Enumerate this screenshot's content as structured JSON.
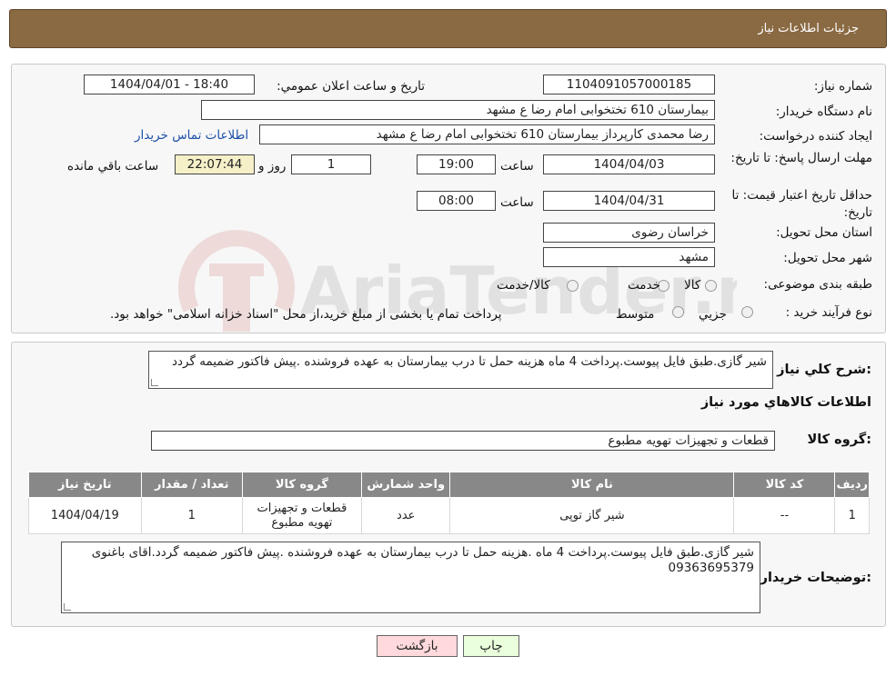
{
  "header": {
    "title": "جزئیات اطلاعات نیاز"
  },
  "form": {
    "need_number_label": "شماره نیاز:",
    "need_number": "1104091057000185",
    "announce_label": "تاریخ و ساعت اعلان عمومي:",
    "announce_value": "1404/04/01 - 18:40",
    "buyer_org_label": "نام دستگاه خریدار:",
    "buyer_org": "بیمارستان 610 تختخوابی امام رضا ع  مشهد",
    "creator_label": "ایجاد کننده درخواست:",
    "creator": "رضا محمدی کارپرداز بیمارستان 610 تختخوابی امام رضا ع  مشهد",
    "contact_link": "اطلاعات تماس خریدار",
    "deadline_label": "مهلت ارسال پاسخ: تا تاریخ:",
    "deadline_date": "1404/04/03",
    "time_label": "ساعت",
    "deadline_time": "19:00",
    "days_value": "1",
    "days_label": "روز و",
    "remaining_time": "22:07:44",
    "remaining_label": "ساعت باقي مانده",
    "validity_label": "حداقل تاریخ اعتبار قیمت: تا تاریخ:",
    "validity_date": "1404/04/31",
    "validity_time": "08:00",
    "province_label": "استان محل تحویل:",
    "province": "خراسان رضوی",
    "city_label": "شهر محل تحویل:",
    "city": "مشهد",
    "category_label": "طبقه بندی موضوعی:",
    "category_options": [
      "کالا",
      "خدمت",
      "کالا/خدمت"
    ],
    "process_label": "نوع فرآیند خرید :",
    "process_options": [
      "جزیي",
      "متوسط"
    ],
    "process_note": "پرداخت تمام یا بخشی از مبلغ خرید،از محل \"اسناد خزانه اسلامی\" خواهد بود."
  },
  "details": {
    "description_label": "شرح کلي نیاز:",
    "description": "شیر گازی.طبق فایل پیوست.پرداخت 4 ماه هزینه حمل تا درب بیمارستان به عهده فروشنده .پیش فاکتور ضمیمه گردد",
    "goods_info_title": "اطلاعات کالاهاي مورد نیاز",
    "goods_group_label": "گروه کالا:",
    "goods_group": "قطعات و تجهیزات تهویه مطبوع",
    "table": {
      "headers": [
        "ردیف",
        "کد کالا",
        "نام کالا",
        "واحد شمارش",
        "گروه کالا",
        "تعداد / مقدار",
        "تاریخ نیاز"
      ],
      "rows": [
        [
          "1",
          "--",
          "شیر گاز توپی",
          "عدد",
          "قطعات و تجهیزات تهویه مطبوع",
          "1",
          "1404/04/19"
        ]
      ]
    },
    "buyer_notes_label": "توضیحات خریدار:",
    "buyer_notes": "شیر گازی.طبق فایل پیوست.پرداخت 4 ماه .هزینه حمل تا درب بیمارستان به عهده فروشنده .پیش فاکتور ضمیمه گردد.اقای باغنوی 09363695379"
  },
  "buttons": {
    "print": "چاپ",
    "back": "بازگشت"
  },
  "watermark": {
    "text": "AriaTender.net"
  },
  "colors": {
    "header": "#8a6a43",
    "table_header": "#888888",
    "print_btn": "#eaffdc",
    "back_btn": "#ffd9dc",
    "link": "#1d4fa8"
  }
}
